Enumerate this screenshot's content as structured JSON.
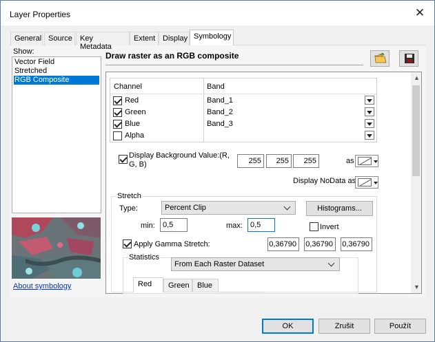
{
  "window": {
    "title": "Layer Properties"
  },
  "tabs": [
    "General",
    "Source",
    "Key Metadata",
    "Extent",
    "Display",
    "Symbology"
  ],
  "show": {
    "label": "Show:",
    "items": [
      "Vector Field",
      "Stretched",
      "RGB Composite"
    ],
    "selected": "RGB Composite"
  },
  "about_link": "About symbology",
  "heading": "Draw raster as an RGB composite",
  "icons": {
    "open": "folder-open-icon",
    "save": "floppy-save-icon"
  },
  "channel_table": {
    "headers": [
      "Channel",
      "Band"
    ],
    "rows": [
      {
        "channel": "Red",
        "band": "Band_1",
        "checked": true
      },
      {
        "channel": "Green",
        "band": "Band_2",
        "checked": true
      },
      {
        "channel": "Blue",
        "band": "Band_3",
        "checked": true
      },
      {
        "channel": "Alpha",
        "band": "",
        "checked": false
      }
    ]
  },
  "background": {
    "label": "Display Background Value:(R, G, B)",
    "checked": true,
    "r": "255",
    "g": "255",
    "b": "255",
    "as_label": "as"
  },
  "nodata": {
    "label": "Display NoData as"
  },
  "stretch": {
    "group_label": "Stretch",
    "type_label": "Type:",
    "type_value": "Percent Clip",
    "histograms_label": "Histograms...",
    "min_label": "min:",
    "min_value": "0,5",
    "max_label": "max:",
    "max_value": "0,5",
    "invert_label": "Invert",
    "invert_checked": false,
    "gamma_label": "Apply Gamma Stretch:",
    "gamma_checked": true,
    "gamma_values": [
      "0,36790",
      "0,36790",
      "0,36790"
    ]
  },
  "statistics": {
    "group_label": "Statistics",
    "source_value": "From Each Raster Dataset",
    "tabs": [
      "Red",
      "Green",
      "Blue"
    ]
  },
  "footer": {
    "ok": "OK",
    "cancel": "Zrušit",
    "apply": "Použít"
  },
  "colors": {
    "accent": "#0078d7",
    "link": "#0033cc"
  }
}
